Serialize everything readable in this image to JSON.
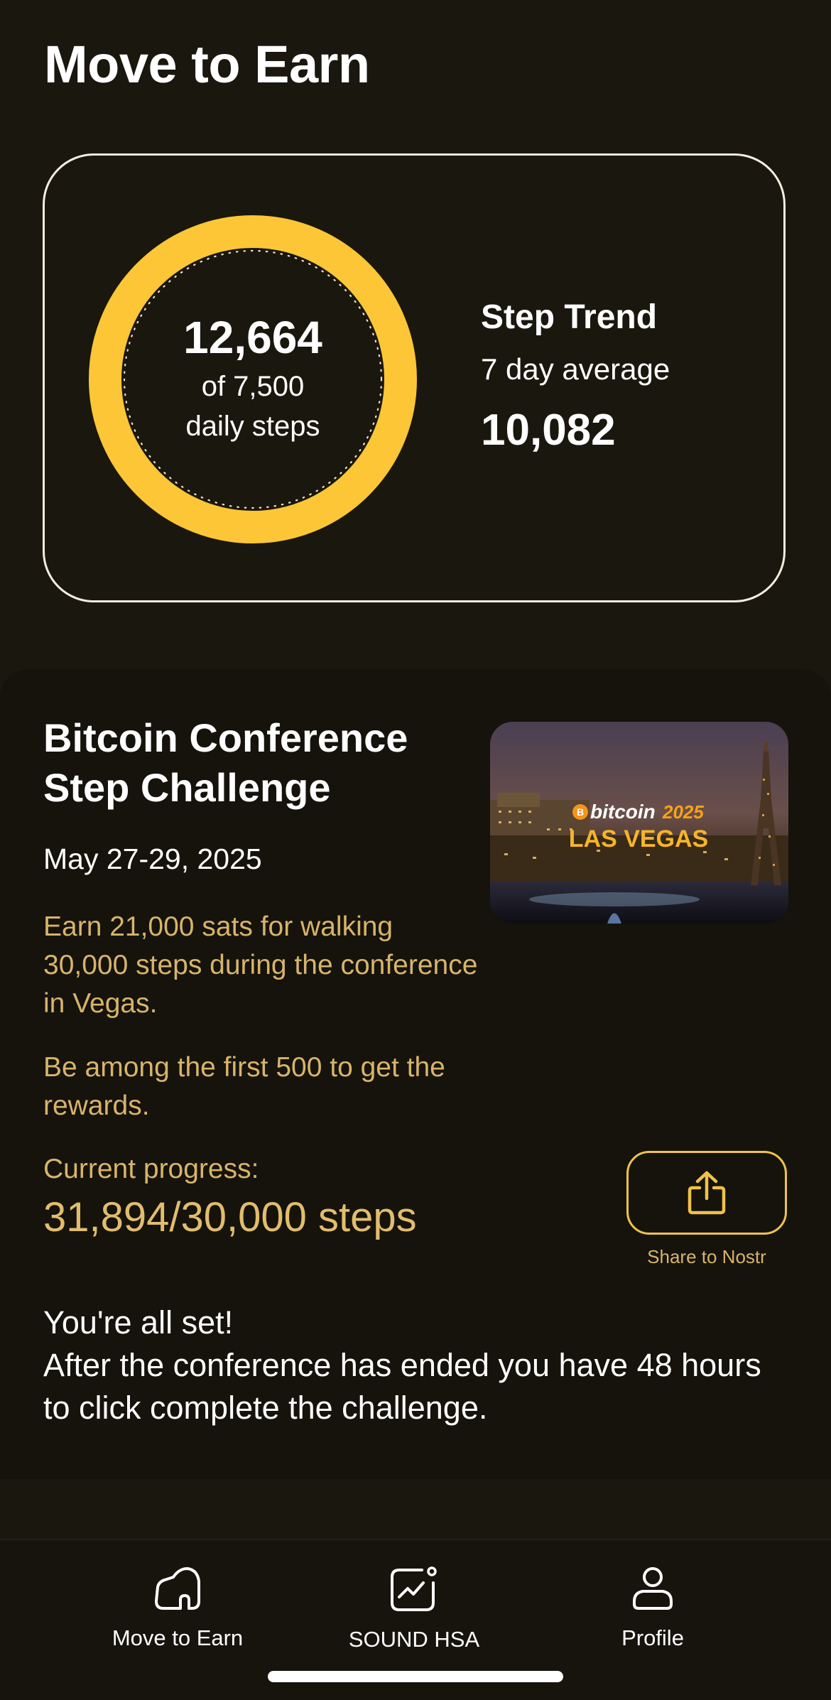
{
  "header": {
    "title": "Move to Earn"
  },
  "steps_card": {
    "steps_today": "12,664",
    "goal_text": "of 7,500",
    "goal_caption": "daily steps",
    "progress_fraction": 1.0,
    "ring_color": "#fcc636",
    "trend_title": "Step Trend",
    "trend_subtitle": "7 day average",
    "trend_value": "10,082"
  },
  "challenge": {
    "title": "Bitcoin Conference Step Challenge",
    "dates": "May 27-29, 2025",
    "description": "Earn 21,000 sats for walking 30,000 steps during the conference in Vegas.",
    "limit_note": "Be among the first 500 to get the rewards.",
    "progress_label": "Current progress:",
    "progress_value": "31,894/30,000 steps",
    "share_label": "Share to Nostr",
    "status_line1": "You're all set!",
    "status_line2": "After the conference has ended you have 48 hours to click complete the challenge.",
    "image": {
      "brand_text": "bitcoin",
      "year_text": "2025",
      "city_text": "LAS VEGAS"
    },
    "accent_color": "#d8b46a"
  },
  "bottom_nav": {
    "items": [
      {
        "label": "Move to Earn",
        "icon": "shoe-icon"
      },
      {
        "label": "SOUND HSA",
        "icon": "chart-icon"
      },
      {
        "label": "Profile",
        "icon": "user-icon"
      }
    ]
  }
}
